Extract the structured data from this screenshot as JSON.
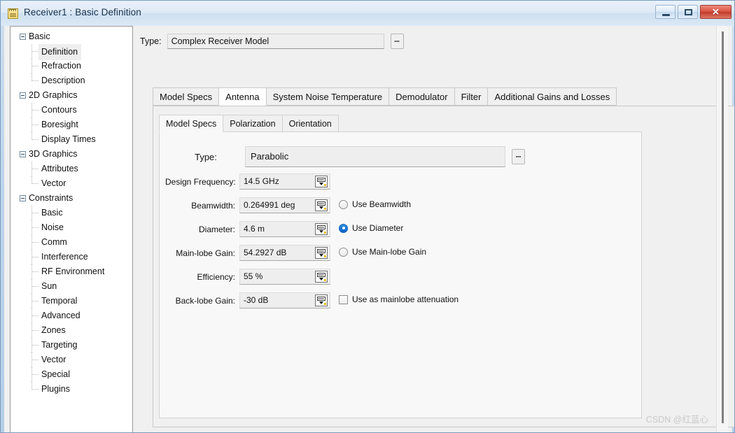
{
  "window": {
    "title": "Receiver1 : Basic Definition",
    "icon": "notepad-icon",
    "caption_buttons": {
      "minimize": "–",
      "maximize": "□",
      "close": "✕"
    }
  },
  "tree": {
    "items": [
      {
        "label": "Basic",
        "level": "group",
        "expanded": true,
        "selected": false,
        "last": false
      },
      {
        "label": "Definition",
        "level": "child",
        "expanded": false,
        "selected": true,
        "last": false
      },
      {
        "label": "Refraction",
        "level": "child",
        "expanded": false,
        "selected": false,
        "last": false
      },
      {
        "label": "Description",
        "level": "child",
        "expanded": false,
        "selected": false,
        "last": true
      },
      {
        "label": "2D Graphics",
        "level": "group",
        "expanded": true,
        "selected": false,
        "last": false
      },
      {
        "label": "Contours",
        "level": "child",
        "expanded": false,
        "selected": false,
        "last": false
      },
      {
        "label": "Boresight",
        "level": "child",
        "expanded": false,
        "selected": false,
        "last": false
      },
      {
        "label": "Display Times",
        "level": "child",
        "expanded": false,
        "selected": false,
        "last": true
      },
      {
        "label": "3D Graphics",
        "level": "group",
        "expanded": true,
        "selected": false,
        "last": false
      },
      {
        "label": "Attributes",
        "level": "child",
        "expanded": false,
        "selected": false,
        "last": false
      },
      {
        "label": "Vector",
        "level": "child",
        "expanded": false,
        "selected": false,
        "last": true
      },
      {
        "label": "Constraints",
        "level": "group",
        "expanded": true,
        "selected": false,
        "last": false
      },
      {
        "label": "Basic",
        "level": "child",
        "expanded": false,
        "selected": false,
        "last": false
      },
      {
        "label": "Noise",
        "level": "child",
        "expanded": false,
        "selected": false,
        "last": false
      },
      {
        "label": "Comm",
        "level": "child",
        "expanded": false,
        "selected": false,
        "last": false
      },
      {
        "label": "Interference",
        "level": "child",
        "expanded": false,
        "selected": false,
        "last": false
      },
      {
        "label": "RF Environment",
        "level": "child",
        "expanded": false,
        "selected": false,
        "last": false
      },
      {
        "label": "Sun",
        "level": "child",
        "expanded": false,
        "selected": false,
        "last": false
      },
      {
        "label": "Temporal",
        "level": "child",
        "expanded": false,
        "selected": false,
        "last": false
      },
      {
        "label": "Advanced",
        "level": "child",
        "expanded": false,
        "selected": false,
        "last": false
      },
      {
        "label": "Zones",
        "level": "child",
        "expanded": false,
        "selected": false,
        "last": false
      },
      {
        "label": "Targeting",
        "level": "child",
        "expanded": false,
        "selected": false,
        "last": false
      },
      {
        "label": "Vector",
        "level": "child",
        "expanded": false,
        "selected": false,
        "last": false
      },
      {
        "label": "Special",
        "level": "child",
        "expanded": false,
        "selected": false,
        "last": false
      },
      {
        "label": "Plugins",
        "level": "child",
        "expanded": false,
        "selected": false,
        "last": true
      }
    ]
  },
  "receiver_type": {
    "label": "Type:",
    "value": "Complex Receiver Model",
    "browse_button": "..."
  },
  "outer_tabs": [
    {
      "label": "Model Specs",
      "active": false
    },
    {
      "label": "Antenna",
      "active": true
    },
    {
      "label": "System Noise Temperature",
      "active": false
    },
    {
      "label": "Demodulator",
      "active": false
    },
    {
      "label": "Filter",
      "active": false
    },
    {
      "label": "Additional Gains and Losses",
      "active": false
    }
  ],
  "inner_tabs": [
    {
      "label": "Model Specs",
      "active": true
    },
    {
      "label": "Polarization",
      "active": false
    },
    {
      "label": "Orientation",
      "active": false
    }
  ],
  "antenna_type": {
    "label": "Type:",
    "value": "Parabolic",
    "browse_button": "..."
  },
  "parameters": [
    {
      "label": "Design Frequency:",
      "value": "14.5 GHz",
      "unit_icon": "unit-calculator-icon",
      "option": null
    },
    {
      "label": "Beamwidth:",
      "value": "0.264991 deg",
      "unit_icon": "unit-calculator-icon",
      "option": {
        "kind": "radio",
        "label": "Use Beamwidth",
        "checked": false
      }
    },
    {
      "label": "Diameter:",
      "value": "4.6 m",
      "unit_icon": "unit-calculator-icon",
      "option": {
        "kind": "radio",
        "label": "Use Diameter",
        "checked": true
      }
    },
    {
      "label": "Main-lobe Gain:",
      "value": "54.2927 dB",
      "unit_icon": "unit-calculator-icon",
      "option": {
        "kind": "radio",
        "label": "Use Main-lobe Gain",
        "checked": false
      }
    },
    {
      "label": "Efficiency:",
      "value": "55 %",
      "unit_icon": "unit-calculator-icon",
      "option": null
    },
    {
      "label": "Back-lobe Gain:",
      "value": "-30 dB",
      "unit_icon": "unit-calculator-icon",
      "option": {
        "kind": "checkbox",
        "label": "Use as mainlobe attenuation",
        "checked": false
      }
    }
  ],
  "watermark": "CSDN @红蓝心",
  "colors": {
    "accent": "#0b62c4",
    "title_gradient_start": "#e9f1fa",
    "title_gradient_end": "#dbe8f5",
    "close_button": "#d9503f",
    "panel": "#f0f0f0",
    "field": "#eeeeee",
    "selection": "#eeeeee"
  }
}
